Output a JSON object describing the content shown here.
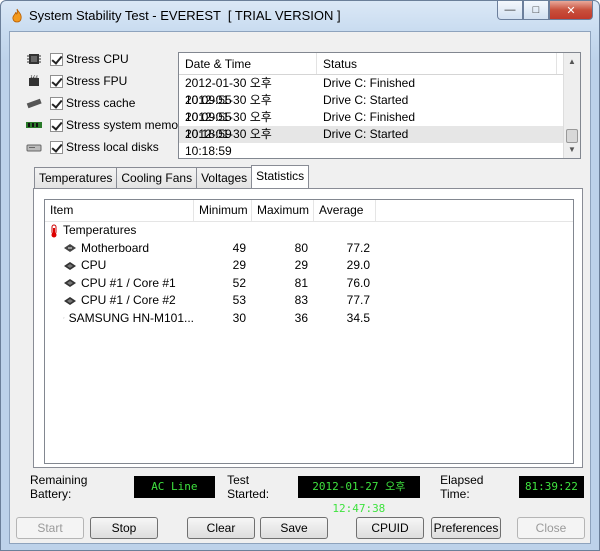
{
  "window": {
    "title": "System Stability Test - EVEREST  [ TRIAL VERSION ]"
  },
  "caption": {
    "minimize": "—",
    "maximize": "□",
    "close": "✕"
  },
  "stress": [
    {
      "label": "Stress CPU",
      "icon": "cpu-icon",
      "checked": true
    },
    {
      "label": "Stress FPU",
      "icon": "fpu-icon",
      "checked": true
    },
    {
      "label": "Stress cache",
      "icon": "cache-icon",
      "checked": true
    },
    {
      "label": "Stress system memory",
      "icon": "memory-icon",
      "checked": true
    },
    {
      "label": "Stress local disks",
      "icon": "disk-icon",
      "checked": true
    }
  ],
  "log": {
    "columns": [
      "Date & Time",
      "Status"
    ],
    "rows": [
      {
        "time": "2012-01-30 오후 10:09:55",
        "status": "Drive C: Finished"
      },
      {
        "time": "2012-01-30 오후 10:09:55",
        "status": "Drive C: Started"
      },
      {
        "time": "2012-01-30 오후 10:18:59",
        "status": "Drive C: Finished"
      },
      {
        "time": "2012-01-30 오후 10:18:59",
        "status": "Drive C: Started"
      }
    ]
  },
  "tabs": [
    "Temperatures",
    "Cooling Fans",
    "Voltages",
    "Statistics"
  ],
  "stats": {
    "columns": [
      "Item",
      "Minimum",
      "Maximum",
      "Average"
    ],
    "group": "Temperatures",
    "rows": [
      {
        "item": "Motherboard",
        "min": "49",
        "max": "80",
        "avg": "77.2",
        "icon": "motherboard-icon"
      },
      {
        "item": "CPU",
        "min": "29",
        "max": "29",
        "avg": "29.0",
        "icon": "cpu-chip-icon"
      },
      {
        "item": "CPU #1 / Core #1",
        "min": "52",
        "max": "81",
        "avg": "76.0",
        "icon": "cpu-chip-icon"
      },
      {
        "item": "CPU #1 / Core #2",
        "min": "53",
        "max": "83",
        "avg": "77.7",
        "icon": "cpu-chip-icon"
      },
      {
        "item": "SAMSUNG HN-M101...",
        "min": "30",
        "max": "36",
        "avg": "34.5",
        "icon": "hard-drive-icon"
      }
    ]
  },
  "status": {
    "battery_label": "Remaining Battery:",
    "battery_value": "AC Line",
    "started_label": "Test Started:",
    "started_value": "2012-01-27 오후 12:47:38",
    "elapsed_label": "Elapsed Time:",
    "elapsed_value": "81:39:22"
  },
  "buttons": {
    "start": "Start",
    "stop": "Stop",
    "clear": "Clear",
    "save": "Save",
    "cpuid": "CPUID",
    "preferences": "Preferences",
    "close": "Close"
  },
  "colors": {
    "lcd_bg": "#000000",
    "lcd_fg": "#3fe23f",
    "window_frame": "#bdd2ea"
  }
}
